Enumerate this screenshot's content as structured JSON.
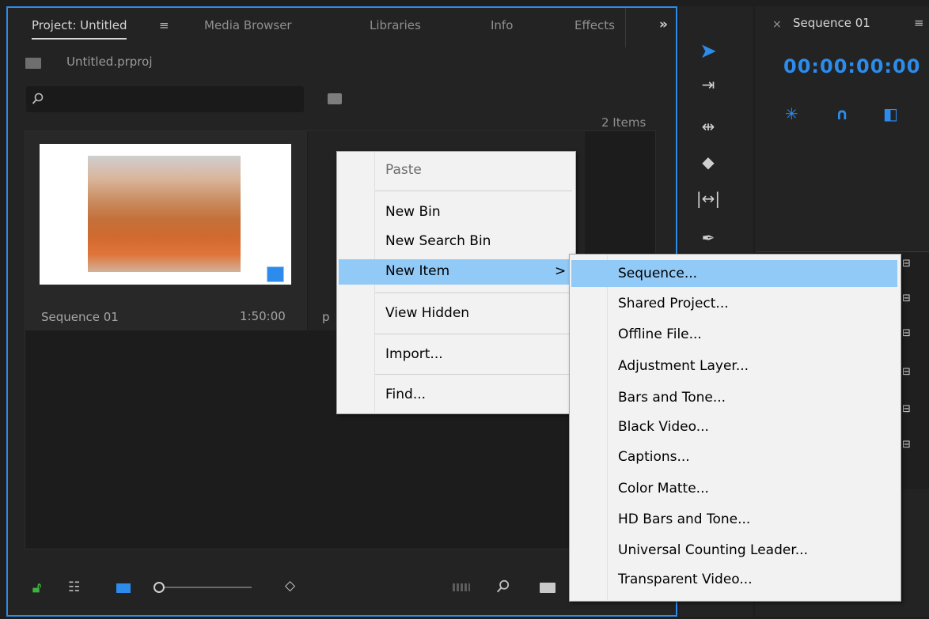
{
  "project_panel": {
    "tabs": [
      "Project: Untitled",
      "Media Browser",
      "Libraries",
      "Info",
      "Effects"
    ],
    "tab_menu_icon": "menu-icon",
    "overflow_icon": "double-chevron-right-icon",
    "project_file": "Untitled.prproj",
    "search_placeholder": "",
    "item_count": "2 Items",
    "items": [
      {
        "name": "Sequence 01",
        "duration": "1:50:00"
      },
      {
        "name": "p"
      }
    ]
  },
  "tools": [
    "selection-tool",
    "track-select-forward-tool",
    "ripple-edit-tool",
    "razor-tool",
    "slip-tool",
    "pen-tool"
  ],
  "sequence_panel": {
    "title": "Sequence 01",
    "close": "×",
    "menu": "≡",
    "timecode": "00:00:00:00"
  },
  "context_menu": {
    "items": [
      "Paste",
      "New Bin",
      "New Search Bin",
      "New Item",
      "View Hidden",
      "Import...",
      "Find..."
    ],
    "submenu_arrow": ">"
  },
  "submenu": {
    "items": [
      "Sequence...",
      "Shared Project...",
      "Offline File...",
      "Adjustment Layer...",
      "Bars and Tone...",
      "Black Video...",
      "Captions...",
      "Color Matte...",
      "HD Bars and Tone...",
      "Universal Counting Leader...",
      "Transparent Video..."
    ]
  },
  "colors": {
    "accent": "#2d8ceb",
    "menu_highlight": "#91c9f7",
    "panel_bg": "#232323"
  }
}
